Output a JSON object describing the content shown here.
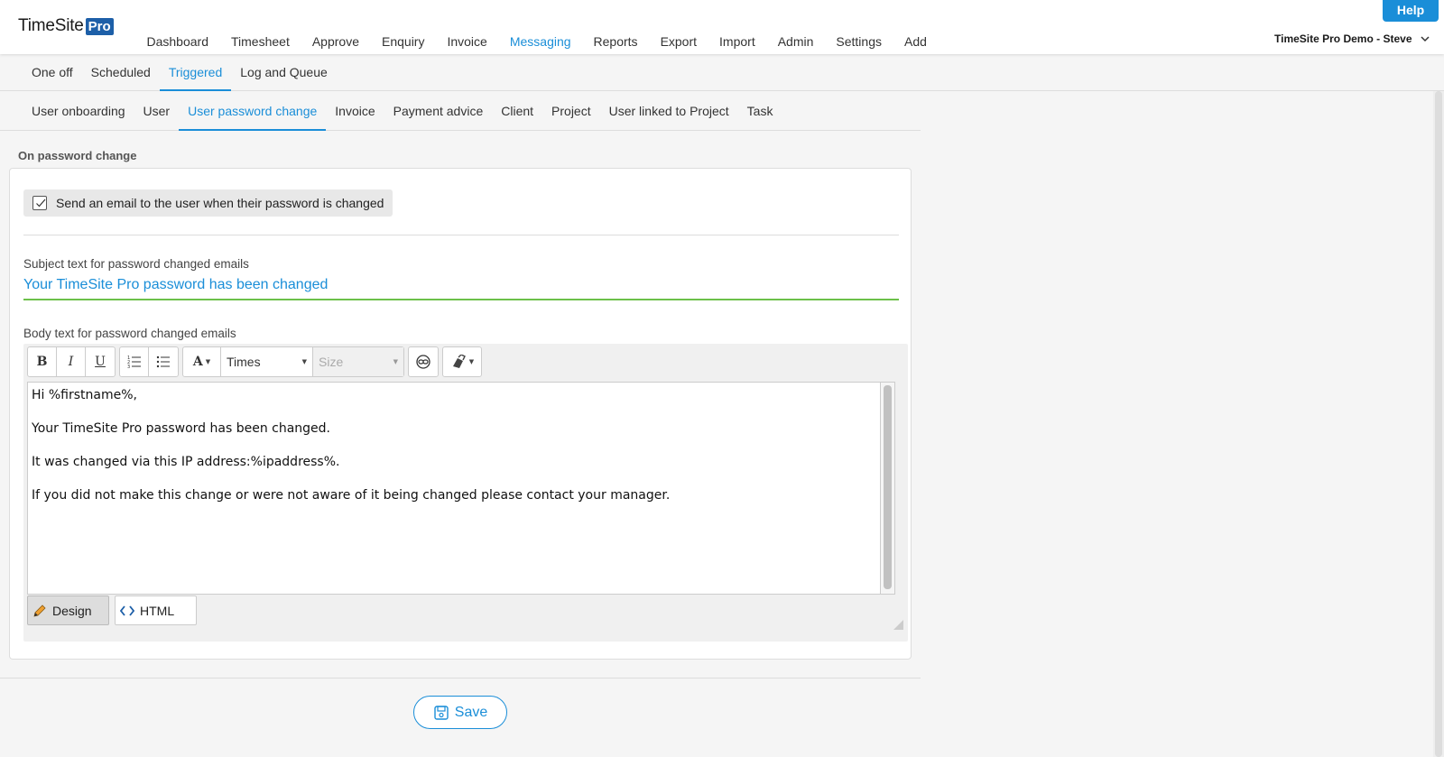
{
  "header": {
    "brand": "TimeSite",
    "brand_badge": "Pro",
    "nav": [
      "Dashboard",
      "Timesheet",
      "Approve",
      "Enquiry",
      "Invoice",
      "Messaging",
      "Reports",
      "Export",
      "Import",
      "Admin",
      "Settings",
      "Add"
    ],
    "active_nav": "Messaging",
    "help_label": "Help",
    "user_menu": "TimeSite Pro Demo - Steve"
  },
  "subnav": {
    "tabs": [
      "One off",
      "Scheduled",
      "Triggered",
      "Log and Queue"
    ],
    "active": "Triggered"
  },
  "triggers": {
    "tabs": [
      "User onboarding",
      "User",
      "User password change",
      "Invoice",
      "Payment advice",
      "Client",
      "Project",
      "User linked to Project",
      "Task"
    ],
    "active": "User password change"
  },
  "section": {
    "title": "On password change",
    "checkbox_label": "Send an email to the user when their password is changed",
    "checkbox_checked": true,
    "subject_label": "Subject text for password changed emails",
    "subject_value": "Your TimeSite Pro password has been changed",
    "body_label": "Body text for password changed emails"
  },
  "editor": {
    "font_name": "Times",
    "size_placeholder": "Size",
    "body_paragraphs": [
      "Hi %firstname%,",
      "Your TimeSite Pro password has been changed.",
      "It was changed via this IP address:%ipaddress%.",
      "If you did not make this change or were not aware of it being changed please contact your manager."
    ],
    "mode_design": "Design",
    "mode_html": "HTML",
    "tool_icons": [
      "bold-icon",
      "italic-icon",
      "underline-icon",
      "ordered-list-icon",
      "unordered-list-icon",
      "font-color-icon",
      "link-icon",
      "clear-format-icon"
    ]
  },
  "footer": {
    "save_label": "Save"
  },
  "colors": {
    "accent": "#1a8ed8",
    "brand_badge": "#1d5fa8",
    "input_focus": "#6cc04a"
  }
}
